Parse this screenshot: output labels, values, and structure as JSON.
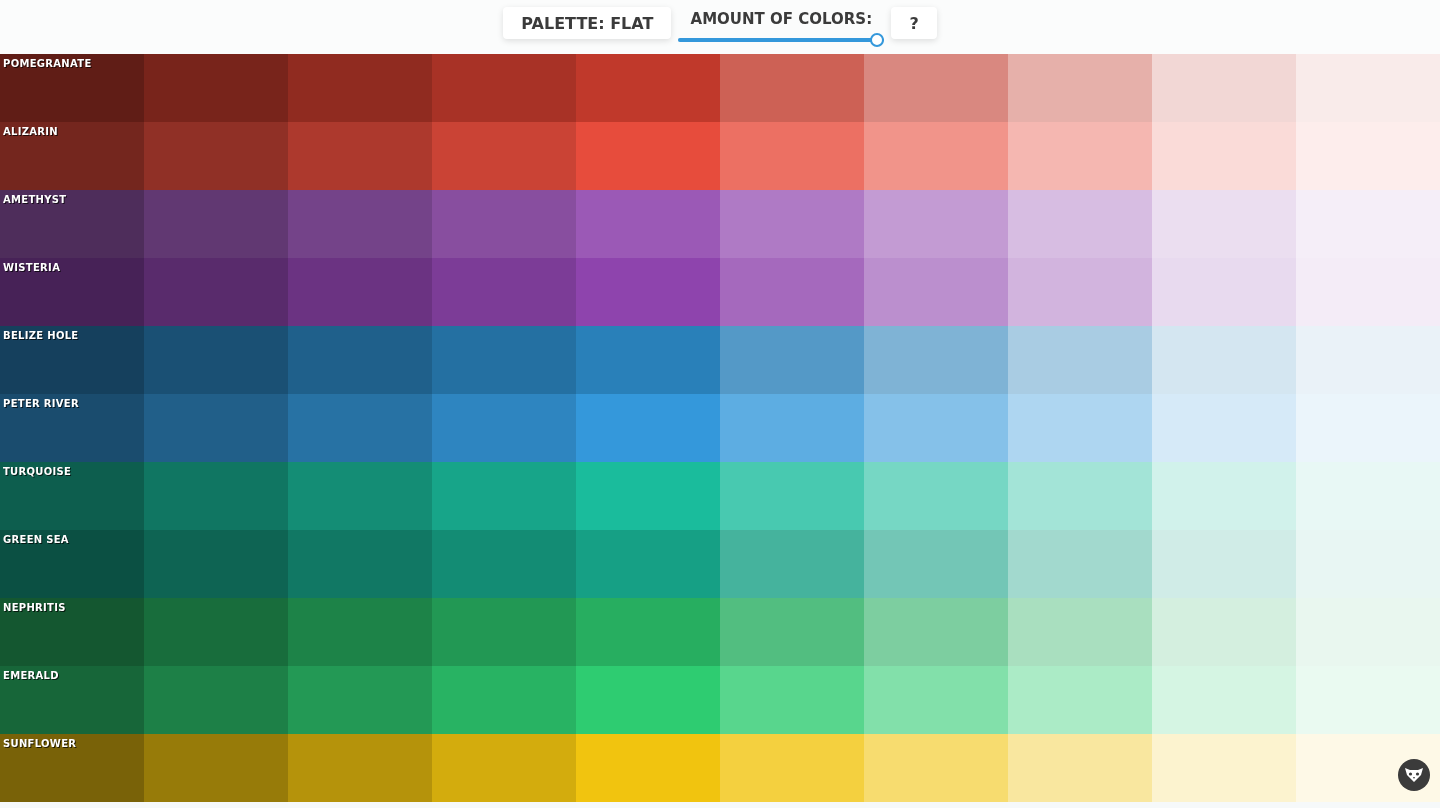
{
  "toolbar": {
    "palette_button": "PALETTE: FLAT",
    "amount_label": "AMOUNT OF COLORS:",
    "amount_slider": {
      "level": 1
    },
    "help_button": "?"
  },
  "rows": [
    {
      "name": "POMEGRANATE",
      "cells": [
        {
          "color": "#601d16"
        },
        {
          "color": "#78241b"
        },
        {
          "color": "#902b20"
        },
        {
          "color": "#a83226"
        },
        {
          "color": "#c0392b"
        },
        {
          "color": "#cd6155"
        },
        {
          "color": "#d98880"
        },
        {
          "color": "#e6b0aa"
        },
        {
          "color": "#f2d7d5"
        },
        {
          "color": "#f9ebea"
        }
      ]
    },
    {
      "name": "ALIZARIN",
      "cells": [
        {
          "color": "#74261e"
        },
        {
          "color": "#903026"
        },
        {
          "color": "#ad392d"
        },
        {
          "color": "#ca4335"
        },
        {
          "color": "#e74c3c"
        },
        {
          "color": "#ec7063"
        },
        {
          "color": "#f1948a"
        },
        {
          "color": "#f5b7b1"
        },
        {
          "color": "#fadbd8"
        },
        {
          "color": "#fdedec"
        }
      ]
    },
    {
      "name": "AMETHYST",
      "cells": [
        {
          "color": "#4e2d5b"
        },
        {
          "color": "#613872"
        },
        {
          "color": "#744389"
        },
        {
          "color": "#884e9f"
        },
        {
          "color": "#9b59b6"
        },
        {
          "color": "#af7ac5"
        },
        {
          "color": "#c39bd3"
        },
        {
          "color": "#d7bde2"
        },
        {
          "color": "#ebdef0"
        },
        {
          "color": "#f5eef8"
        }
      ]
    },
    {
      "name": "WISTERIA",
      "cells": [
        {
          "color": "#472257"
        },
        {
          "color": "#592b6c"
        },
        {
          "color": "#6b3382"
        },
        {
          "color": "#7c3c97"
        },
        {
          "color": "#8e44ad"
        },
        {
          "color": "#a569bd"
        },
        {
          "color": "#bb8fce"
        },
        {
          "color": "#d2b4de"
        },
        {
          "color": "#e8daef"
        },
        {
          "color": "#f4ecf7"
        }
      ]
    },
    {
      "name": "BELIZE HOLE",
      "cells": [
        {
          "color": "#15405d"
        },
        {
          "color": "#1a5074"
        },
        {
          "color": "#1f608b"
        },
        {
          "color": "#2470a2"
        },
        {
          "color": "#2980b9"
        },
        {
          "color": "#5499c7"
        },
        {
          "color": "#7fb3d5"
        },
        {
          "color": "#a9cce3"
        },
        {
          "color": "#d4e6f1"
        },
        {
          "color": "#eaf2f8"
        }
      ]
    },
    {
      "name": "PETER RIVER",
      "cells": [
        {
          "color": "#1a4c6e"
        },
        {
          "color": "#215f89"
        },
        {
          "color": "#2772a4"
        },
        {
          "color": "#2e85c0"
        },
        {
          "color": "#3498db"
        },
        {
          "color": "#5dade2"
        },
        {
          "color": "#85c1e9"
        },
        {
          "color": "#aed6f1"
        },
        {
          "color": "#d6eaf8"
        },
        {
          "color": "#ebf5fb"
        }
      ]
    },
    {
      "name": "TURQUOISE",
      "cells": [
        {
          "color": "#0d5e4e"
        },
        {
          "color": "#107662"
        },
        {
          "color": "#148d75"
        },
        {
          "color": "#17a589"
        },
        {
          "color": "#1abc9c"
        },
        {
          "color": "#48c9b0"
        },
        {
          "color": "#76d7c4"
        },
        {
          "color": "#a3e4d7"
        },
        {
          "color": "#d1f2eb"
        },
        {
          "color": "#e8f8f5"
        }
      ]
    },
    {
      "name": "GREEN SEA",
      "cells": [
        {
          "color": "#0b5043"
        },
        {
          "color": "#0e6453"
        },
        {
          "color": "#117864"
        },
        {
          "color": "#138c74"
        },
        {
          "color": "#16a085"
        },
        {
          "color": "#45b39d"
        },
        {
          "color": "#73c6b6"
        },
        {
          "color": "#a2d9ce"
        },
        {
          "color": "#d0ece7"
        },
        {
          "color": "#e8f6f3"
        }
      ]
    },
    {
      "name": "NEPHRITIS",
      "cells": [
        {
          "color": "#145730"
        },
        {
          "color": "#186d3c"
        },
        {
          "color": "#1d8348"
        },
        {
          "color": "#229854"
        },
        {
          "color": "#27ae60"
        },
        {
          "color": "#52be80"
        },
        {
          "color": "#7dcea0"
        },
        {
          "color": "#a9dfbf"
        },
        {
          "color": "#d4efdf"
        },
        {
          "color": "#e9f7ef"
        }
      ]
    },
    {
      "name": "EMERALD",
      "cells": [
        {
          "color": "#176639"
        },
        {
          "color": "#1d8047"
        },
        {
          "color": "#239955"
        },
        {
          "color": "#28b363"
        },
        {
          "color": "#2ecc71"
        },
        {
          "color": "#58d68d"
        },
        {
          "color": "#82e0aa"
        },
        {
          "color": "#abebc6"
        },
        {
          "color": "#d5f5e3"
        },
        {
          "color": "#eafaf1"
        }
      ]
    },
    {
      "name": "SUNFLOWER",
      "cells": [
        {
          "color": "#796208"
        },
        {
          "color": "#977b09"
        },
        {
          "color": "#b5930b"
        },
        {
          "color": "#d3ac0d"
        },
        {
          "color": "#f1c40f"
        },
        {
          "color": "#f4d03f"
        },
        {
          "color": "#f7dc6f"
        },
        {
          "color": "#f9e79f"
        },
        {
          "color": "#fcf3cf"
        },
        {
          "color": "#fef9e7"
        }
      ]
    }
  ]
}
